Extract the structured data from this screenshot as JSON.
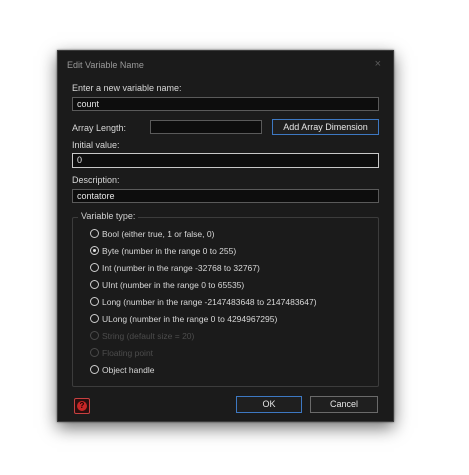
{
  "dialog": {
    "title": "Edit Variable Name",
    "close_glyph": "×",
    "name_label": "Enter a new variable name:",
    "name_value": "count",
    "array_label": "Array Length:",
    "array_value": "",
    "add_array_button": "Add Array Dimension",
    "initial_label": "Initial value:",
    "initial_value": "0",
    "description_label": "Description:",
    "description_value": "contatore",
    "type_group_label": "Variable type:",
    "types": [
      {
        "label": "Bool (either true, 1 or false, 0)",
        "selected": false,
        "enabled": true
      },
      {
        "label": "Byte (number in the range 0 to 255)",
        "selected": true,
        "enabled": true
      },
      {
        "label": "Int (number in the range -32768 to 32767)",
        "selected": false,
        "enabled": true
      },
      {
        "label": "UInt (number in the range 0 to 65535)",
        "selected": false,
        "enabled": true
      },
      {
        "label": "Long (number in the range -2147483648 to 2147483647)",
        "selected": false,
        "enabled": true
      },
      {
        "label": "ULong (number in the range 0 to 4294967295)",
        "selected": false,
        "enabled": true
      },
      {
        "label": "String (default size = 20)",
        "selected": false,
        "enabled": false
      },
      {
        "label": "Floating point",
        "selected": false,
        "enabled": false
      },
      {
        "label": "Object handle",
        "selected": false,
        "enabled": true
      }
    ],
    "ok_button": "OK",
    "cancel_button": "Cancel",
    "help_icon": "help-icon",
    "colors": {
      "accent": "#3d78c2",
      "background": "#1b1b1b",
      "help": "#c72626"
    }
  }
}
